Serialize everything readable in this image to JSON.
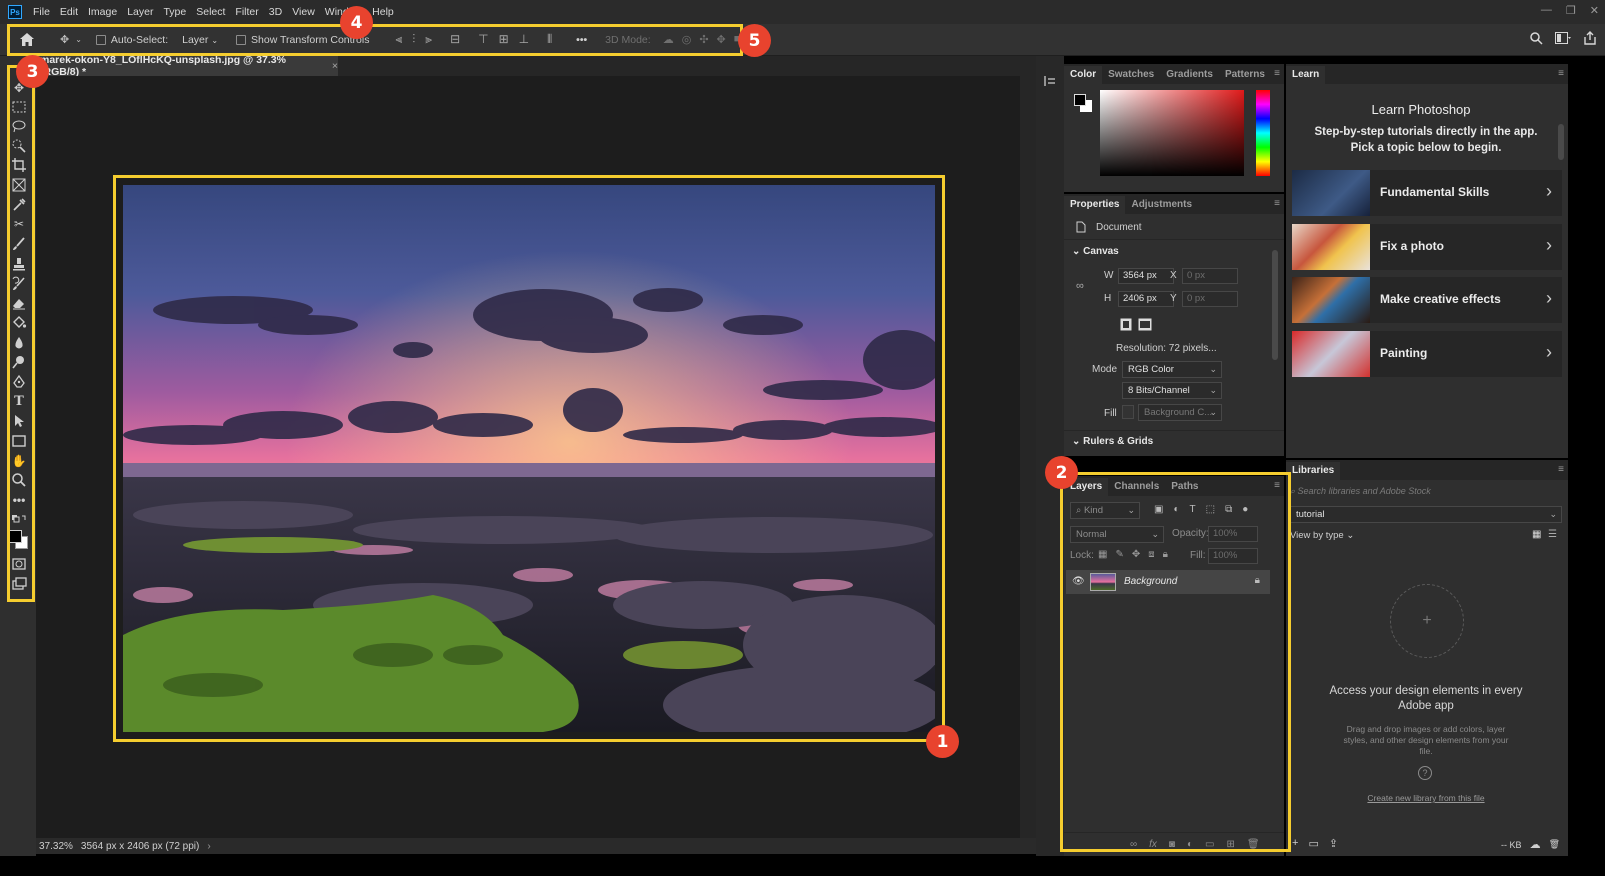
{
  "menubar": {
    "logo": "Ps",
    "items": [
      "File",
      "Edit",
      "Image",
      "Layer",
      "Type",
      "Select",
      "Filter",
      "3D",
      "View",
      "Window",
      "Help"
    ]
  },
  "options": {
    "auto_select_label": "Auto-Select:",
    "auto_select_value": "Layer",
    "show_transform_label": "Show Transform Controls",
    "mode_3d_label": "3D Mode:",
    "more_label": "•••"
  },
  "document": {
    "tab_title": "marek-okon-Y8_LOflHcKQ-unsplash.jpg @ 37.3% (RGB/8) *",
    "zoom": "37.32%",
    "dimensions": "3564 px x 2406 px (72 ppi)"
  },
  "color_panel": {
    "tabs": [
      "Color",
      "Swatches",
      "Gradients",
      "Patterns"
    ]
  },
  "properties_panel": {
    "tabs": [
      "Properties",
      "Adjustments"
    ],
    "doc_label": "Document",
    "canvas_section": "Canvas",
    "w_label": "W",
    "w_value": "3564 px",
    "h_label": "H",
    "h_value": "2406 px",
    "x_label": "X",
    "x_value": "0 px",
    "y_label": "Y",
    "y_value": "0 px",
    "resolution": "Resolution:  72 pixels...",
    "mode_label": "Mode",
    "mode_value": "RGB Color",
    "bits_value": "8 Bits/Channel",
    "fill_label": "Fill",
    "fill_value": "Background C...",
    "rulers_section": "Rulers & Grids"
  },
  "layers_panel": {
    "tabs": [
      "Layers",
      "Channels",
      "Paths"
    ],
    "kind_label": "Kind",
    "blend_mode": "Normal",
    "opacity_label": "Opacity:",
    "opacity_value": "100%",
    "lock_label": "Lock:",
    "fill_label": "Fill:",
    "fill_value": "100%",
    "layer_name": "Background"
  },
  "learn_panel": {
    "tab": "Learn",
    "title": "Learn Photoshop",
    "subtitle": "Step-by-step tutorials directly in the app. Pick a topic below to begin.",
    "items": [
      {
        "label": "Fundamental Skills"
      },
      {
        "label": "Fix a photo"
      },
      {
        "label": "Make creative effects"
      },
      {
        "label": "Painting"
      }
    ]
  },
  "libraries_panel": {
    "tab": "Libraries",
    "search_placeholder": "Search libraries and Adobe Stock",
    "library_value": "tutorial",
    "view_by": "View by type",
    "empty_title": "Access your design elements in every Adobe app",
    "empty_body": "Drag and drop images or add colors, layer styles, and other design elements from your file.",
    "create_link": "Create new library from this file",
    "size_label": "-- KB"
  },
  "annotations": {
    "m1": "1",
    "m2": "2",
    "m3": "3",
    "m4": "4",
    "m5": "5"
  },
  "colors": {
    "accent_yellow": "#f5cd2f",
    "marker_red": "#e8432e",
    "app_bg": "#1d1d1d",
    "panel_bg": "#2f2f2f"
  }
}
